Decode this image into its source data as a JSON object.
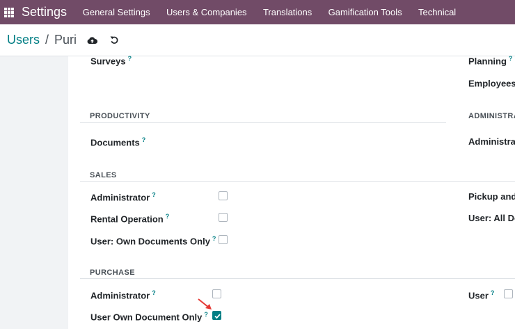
{
  "navbar": {
    "brand": "Settings",
    "items": [
      "General Settings",
      "Users & Companies",
      "Translations",
      "Gamification Tools",
      "Technical"
    ]
  },
  "breadcrumb": {
    "parent": "Users",
    "separator": "/",
    "current": "Puri"
  },
  "icons": {
    "save": "cloud-upload-icon",
    "discard": "undo-icon",
    "apps": "apps-grid-icon"
  },
  "labels": {
    "surveys": "Surveys",
    "planning": "Planning",
    "employees": "Employees",
    "documents": "Documents",
    "administration_right": "Administrat",
    "sales_administrator": "Administrator",
    "rental_operation": "Rental Operation",
    "user_own_documents_only": "User: Own Documents Only",
    "pickup": "Pickup and",
    "user_all_docs": "User: All Do",
    "purchase_administrator": "Administrator",
    "user_own_document_only": "User Own Document Only",
    "purchase_user": "User"
  },
  "sections": {
    "productivity": "PRODUCTIVITY",
    "administration": "ADMINISTRA",
    "sales": "SALES",
    "purchase": "PURCHASE"
  },
  "help_mark": "?",
  "checkboxes": {
    "sales_administrator": false,
    "rental_operation": false,
    "user_own_documents_only": false,
    "purchase_administrator": false,
    "user_own_document_only": true,
    "purchase_user": false
  },
  "colors": {
    "brand": "#714B67",
    "accent": "#017e84",
    "annotation": "#e53935"
  }
}
